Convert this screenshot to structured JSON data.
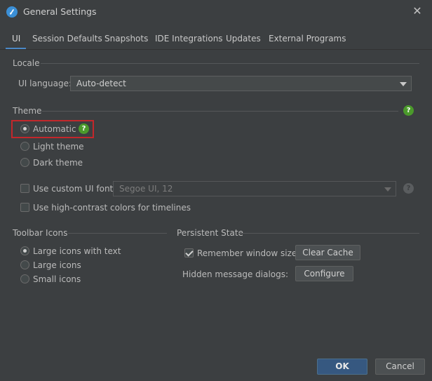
{
  "window": {
    "title": "General Settings",
    "close_glyph": "✕",
    "icon": "app-logo-icon"
  },
  "tabs": [
    {
      "label": "UI",
      "active": true
    },
    {
      "label": "Session Defaults"
    },
    {
      "label": "Snapshots"
    },
    {
      "label": "IDE Integrations"
    },
    {
      "label": "Updates"
    },
    {
      "label": "External Programs"
    }
  ],
  "locale": {
    "section_title": "Locale",
    "ui_language_label": "UI language:",
    "ui_language_value": "Auto-detect"
  },
  "theme": {
    "section_title": "Theme",
    "help_glyph": "?",
    "options": [
      {
        "label": "Automatic",
        "selected": true
      },
      {
        "label": "Light theme",
        "selected": false
      },
      {
        "label": "Dark theme",
        "selected": false
      }
    ],
    "custom_font_label": "Use custom UI font:",
    "custom_font_value": "Segoe UI, 12",
    "high_contrast_label": "Use high-contrast colors for timelines"
  },
  "toolbar_icons": {
    "section_title": "Toolbar Icons",
    "options": [
      {
        "label": "Large icons with text",
        "selected": true
      },
      {
        "label": "Large icons",
        "selected": false
      },
      {
        "label": "Small icons",
        "selected": false
      }
    ]
  },
  "persistent_state": {
    "section_title": "Persistent State",
    "remember_label": "Remember window sizes",
    "remember_checked": true,
    "clear_cache_label": "Clear Cache",
    "hidden_dialogs_label": "Hidden message dialogs:",
    "configure_label": "Configure"
  },
  "footer": {
    "ok_label": "OK",
    "cancel_label": "Cancel"
  },
  "colors": {
    "background": "#3c3f41",
    "accent": "#4a88c7",
    "primary_button": "#365880",
    "help_green": "#4b9a2b",
    "highlight_red": "#c3272b"
  }
}
